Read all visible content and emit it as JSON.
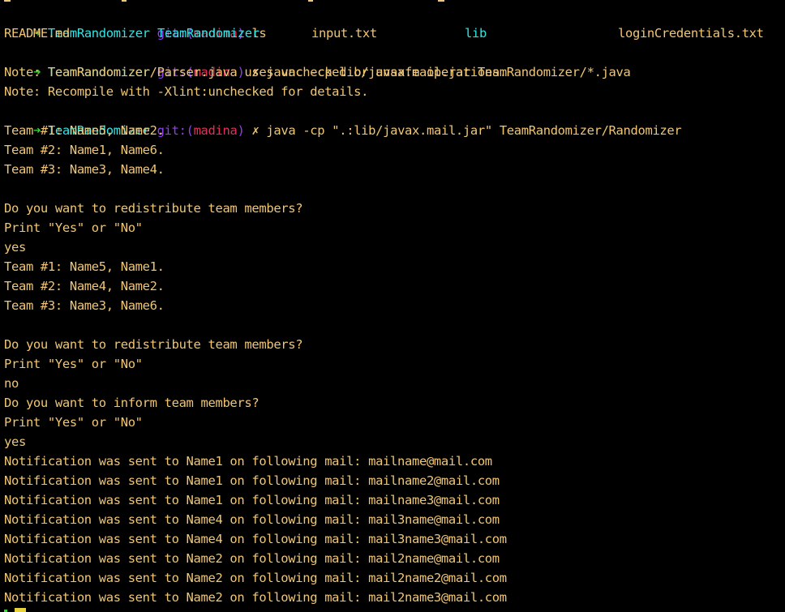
{
  "prompt": {
    "arrow": "➜",
    "directory": "TeamRandomizer",
    "git_label": "git:",
    "branch_open": "(",
    "branch": "madina",
    "branch_close": ")",
    "dirty_marker": "✗"
  },
  "commands": {
    "ls": "ls",
    "javac": "javac -cp lib/javax.mail.jar TeamRandomizer/*.java",
    "java": "java -cp \".:lib/javax.mail.jar\" TeamRandomizer/Randomizer"
  },
  "ls_output": [
    {
      "name": "README.md",
      "kind": "file"
    },
    {
      "name": "TeamRandomizer",
      "kind": "directory"
    },
    {
      "name": "input.txt",
      "kind": "file"
    },
    {
      "name": "lib",
      "kind": "directory"
    },
    {
      "name": "loginCredentials.txt",
      "kind": "file"
    }
  ],
  "compile_notes": [
    "Note: TeamRandomizer/Parser.java uses unchecked or unsafe operations.",
    "Note: Recompile with -Xlint:unchecked for details."
  ],
  "run_output": [
    "Team #1: Name5, Name2.",
    "Team #2: Name1, Name6.",
    "Team #3: Name3, Name4.",
    "",
    "Do you want to redistribute team members?",
    "Print \"Yes\" or \"No\"",
    "yes",
    "Team #1: Name5, Name1.",
    "Team #2: Name4, Name2.",
    "Team #3: Name3, Name6.",
    "",
    "Do you want to redistribute team members?",
    "Print \"Yes\" or \"No\"",
    "no",
    "Do you want to inform team members?",
    "Print \"Yes\" or \"No\"",
    "yes",
    "Notification was sent to Name1 on following mail: mailname@mail.com",
    "Notification was sent to Name1 on following mail: mailname2@mail.com",
    "Notification was sent to Name1 on following mail: mailname3@mail.com",
    "Notification was sent to Name4 on following mail: mail3name@mail.com",
    "Notification was sent to Name4 on following mail: mail3name3@mail.com",
    "Notification was sent to Name2 on following mail: mail2name@mail.com",
    "Notification was sent to Name2 on following mail: mail2name2@mail.com",
    "Notification was sent to Name2 on following mail: mail2name3@mail.com"
  ],
  "colors": {
    "background": "#000000",
    "text": "#f0c674",
    "prompt_arrow": "#3ad13a",
    "directory": "#2ee6e6",
    "git": "#8f3ff0",
    "branch": "#e0305a",
    "cursor": "#e8d23a"
  }
}
